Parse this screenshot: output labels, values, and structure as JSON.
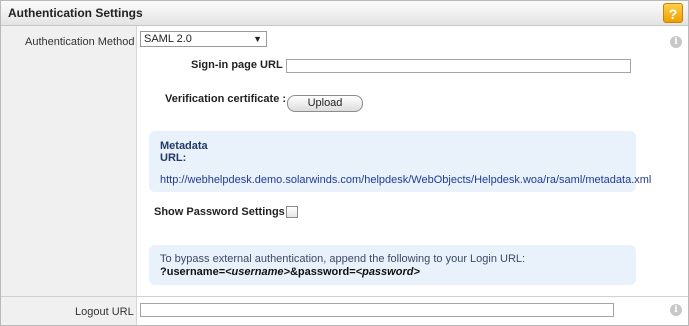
{
  "header": {
    "title": "Authentication Settings",
    "help_label": "?"
  },
  "auth_method": {
    "label": "Authentication Method",
    "selected": "SAML 2.0"
  },
  "signin": {
    "label": "Sign-in page URL :",
    "value": ""
  },
  "verification": {
    "label": "Verification certificate :",
    "button_label": "Upload"
  },
  "metadata": {
    "title_line1": "Metadata",
    "title_line2": "URL:",
    "url": "http://webhelpdesk.demo.solarwinds.com/helpdesk/WebObjects/Helpdesk.woa/ra/saml/metadata.xml"
  },
  "show_password": {
    "label": "Show Password Settings :",
    "checked": false
  },
  "bypass": {
    "line1": "To bypass external authentication, append the following to your Login URL:",
    "p1": "?username=",
    "p2": "<username>",
    "p3": "&password=",
    "p4": "<password>"
  },
  "logout": {
    "label": "Logout URL",
    "value": ""
  },
  "icons": {
    "info": "info-icon",
    "dropdown": "chevron-down-icon",
    "help": "help-icon"
  },
  "colors": {
    "accent_help": "#f5b400",
    "info_box": "#e9f1fb",
    "link": "#1f3b99"
  }
}
